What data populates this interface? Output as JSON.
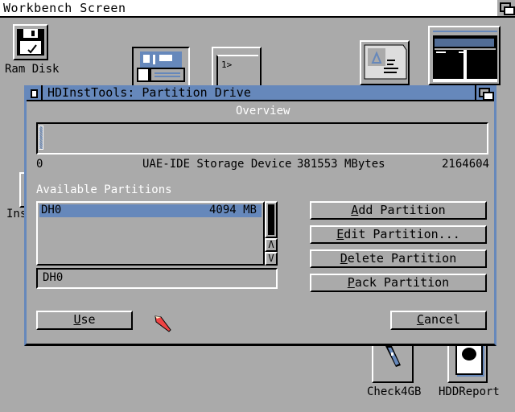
{
  "screen": {
    "title": "Workbench Screen"
  },
  "desktop_icons": [
    {
      "name": "ram-disk",
      "label": "Ram Disk"
    },
    {
      "name": "partially-hidden",
      "label": "Ins"
    },
    {
      "name": "check4gb",
      "label": "Check4GB"
    },
    {
      "name": "hddreport",
      "label": "HDDReport"
    }
  ],
  "window": {
    "title": "HDInstTools: Partition Drive",
    "overview": {
      "label": "Overview",
      "start_value": "0",
      "device_name": "UAE-IDE Storage Device",
      "device_size": "381553 MBytes",
      "end_value": "2164604"
    },
    "partitions": {
      "label": "Available Partitions",
      "items": [
        {
          "name": "DH0",
          "size": "4094 MB",
          "selected": true
        }
      ],
      "name_field_value": "DH0"
    },
    "buttons": {
      "add": {
        "hotkey": "A",
        "rest": "dd Partition"
      },
      "edit": {
        "hotkey": "E",
        "rest": "dit Partition..."
      },
      "delete": {
        "hotkey": "D",
        "rest": "elete Partition"
      },
      "pack": {
        "hotkey": "P",
        "rest": "ack Partition"
      },
      "use": {
        "hotkey": "U",
        "rest": "se"
      },
      "cancel": {
        "hotkey": "C",
        "rest": "ancel"
      }
    }
  },
  "colors": {
    "accent": "#6688bb",
    "background": "#aaaaaa",
    "pointer": "#ee4444"
  }
}
